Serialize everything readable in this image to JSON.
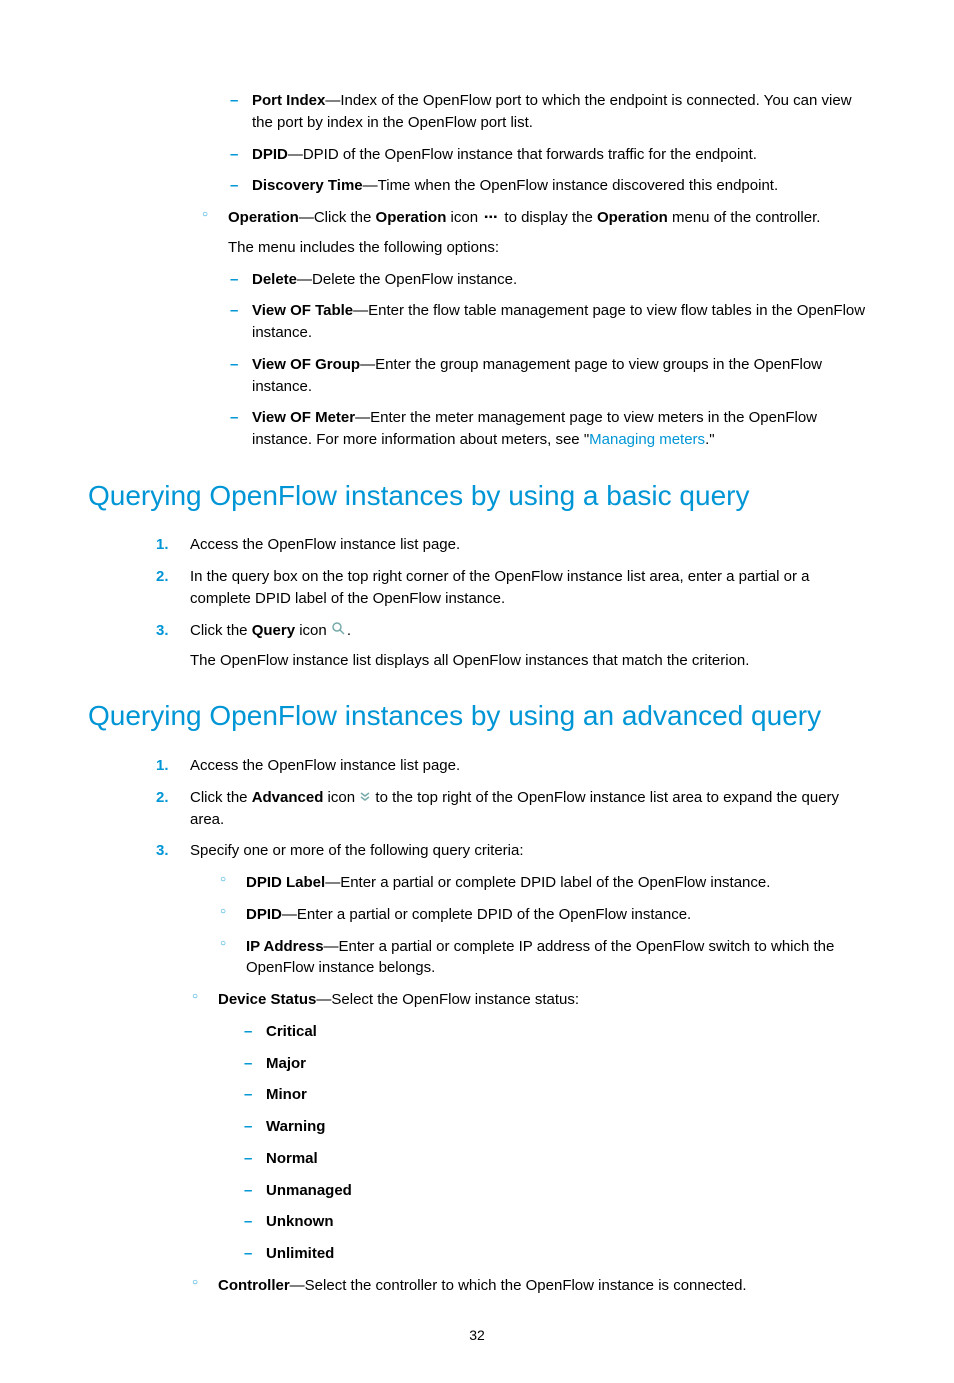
{
  "top_dash": [
    {
      "term": "Port Index",
      "desc": "—Index of the OpenFlow port to which the endpoint is connected. You can view the port by index in the OpenFlow port list."
    },
    {
      "term": "DPID",
      "desc": "—DPID of the OpenFlow instance that forwards traffic for the endpoint."
    },
    {
      "term": "Discovery Time",
      "desc": "—Time when the OpenFlow instance discovered this endpoint."
    }
  ],
  "operation": {
    "term": "Operation",
    "part1": "—Click the ",
    "bold": "Operation",
    "part2": " icon ",
    "part3": " to display the ",
    "bold2": "Operation",
    "part4": " menu of the controller.",
    "sub": "The menu includes the following options:",
    "items": [
      {
        "term": "Delete",
        "desc": "—Delete the OpenFlow instance."
      },
      {
        "term": "View OF Table",
        "desc": "—Enter the flow table management page to view flow tables in the OpenFlow instance."
      },
      {
        "term": "View OF Group",
        "desc": "—Enter the group management page to view groups in the OpenFlow instance."
      },
      {
        "term": "View OF Meter",
        "desc_pre": "—Enter the meter management page to view meters in the OpenFlow instance. For more information about meters, see \"",
        "link": "Managing meters",
        "desc_post": ".\""
      }
    ]
  },
  "h_basic": "Querying OpenFlow instances by using a basic query",
  "basic_steps": {
    "s1": "Access the OpenFlow instance list page.",
    "s2": "In the query box on the top right corner of the OpenFlow instance list area, enter a partial or a complete DPID label of the OpenFlow instance.",
    "s3_pre": "Click the ",
    "s3_bold": "Query",
    "s3_mid": " icon ",
    "s3_post": ".",
    "s3_sub": "The OpenFlow instance list displays all OpenFlow instances that match the criterion."
  },
  "h_adv": "Querying OpenFlow instances by using an advanced query",
  "adv_steps": {
    "s1": "Access the OpenFlow instance list page.",
    "s2_pre": "Click the ",
    "s2_bold": "Advanced",
    "s2_mid": " icon  ",
    "s2_post": " to the top right of the OpenFlow instance list area to expand the query area.",
    "s3": "Specify one or more of the following query criteria:",
    "criteria": [
      {
        "term": "DPID Label",
        "desc": "—Enter a partial or complete DPID label of the OpenFlow instance."
      },
      {
        "term": "DPID",
        "desc": "—Enter a partial or complete DPID of the OpenFlow instance."
      },
      {
        "term": "IP Address",
        "desc": "—Enter a partial or complete IP address of the OpenFlow switch to which the OpenFlow instance belongs."
      }
    ],
    "device_status": {
      "term": "Device Status",
      "desc": "—Select the OpenFlow instance status:",
      "opts": [
        "Critical",
        "Major",
        "Minor",
        "Warning",
        "Normal",
        "Unmanaged",
        "Unknown",
        "Unlimited"
      ]
    },
    "controller": {
      "term": "Controller",
      "desc": "—Select the controller to which the OpenFlow instance is connected."
    }
  },
  "pagenum": "32"
}
